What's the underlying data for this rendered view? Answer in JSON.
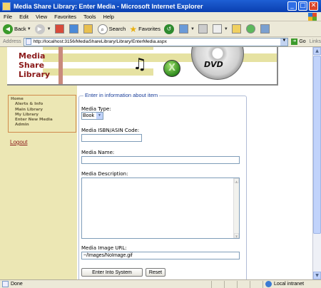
{
  "window": {
    "title": "Media Share Library: Enter Media - Microsoft Internet Explorer",
    "controls": {
      "minimize": "_",
      "maximize": "□",
      "close": "✕"
    }
  },
  "menu": [
    "File",
    "Edit",
    "View",
    "Favorites",
    "Tools",
    "Help"
  ],
  "toolbar": {
    "back": "Back",
    "search": "Search",
    "favorites": "Favorites",
    "icons": [
      "back-icon",
      "forward-icon",
      "stop-icon",
      "refresh-icon",
      "home-icon",
      "search-icon",
      "favorites-icon",
      "history-icon",
      "mail-icon",
      "print-icon",
      "edit-icon",
      "folder-icon",
      "messenger-icon",
      "research-icon"
    ]
  },
  "address": {
    "label": "Address",
    "url": "http://localhost:3156/MediaShareLibrary/Library/EnterMedia.aspx",
    "go": "Go",
    "links": "Links"
  },
  "banner": {
    "title": "Media\nShare\nLibrary",
    "dvd": "DVD",
    "note_glyph": "♫",
    "xbox_glyph": "X",
    "colors": {
      "stripe": "#e6e2a2",
      "title": "#8b1a1a",
      "bar": "#c98a7c"
    }
  },
  "nav": {
    "items": [
      {
        "label": "Home",
        "sub": false
      },
      {
        "label": "Alerts & Info",
        "sub": true
      },
      {
        "label": "Main Library",
        "sub": true
      },
      {
        "label": "My Library",
        "sub": true
      },
      {
        "label": "Enter New Media",
        "sub": true
      },
      {
        "label": "Admin",
        "sub": true
      }
    ],
    "logout": "Logout"
  },
  "form": {
    "legend": "Enter in information about item",
    "media_type_label": "Media Type:",
    "media_type_value": "Book",
    "isbn_label": "Media ISBN/ASIN Code:",
    "isbn_value": "",
    "name_label": "Media Name:",
    "name_value": "",
    "description_label": "Media Description:",
    "description_value": "",
    "image_url_label": "Media Image URL:",
    "image_url_value": "~/Images/NoImage.gif",
    "submit_label": "Enter Into System",
    "reset_label": "Reset"
  },
  "status": {
    "text": "Done",
    "zone": "Local intranet"
  }
}
